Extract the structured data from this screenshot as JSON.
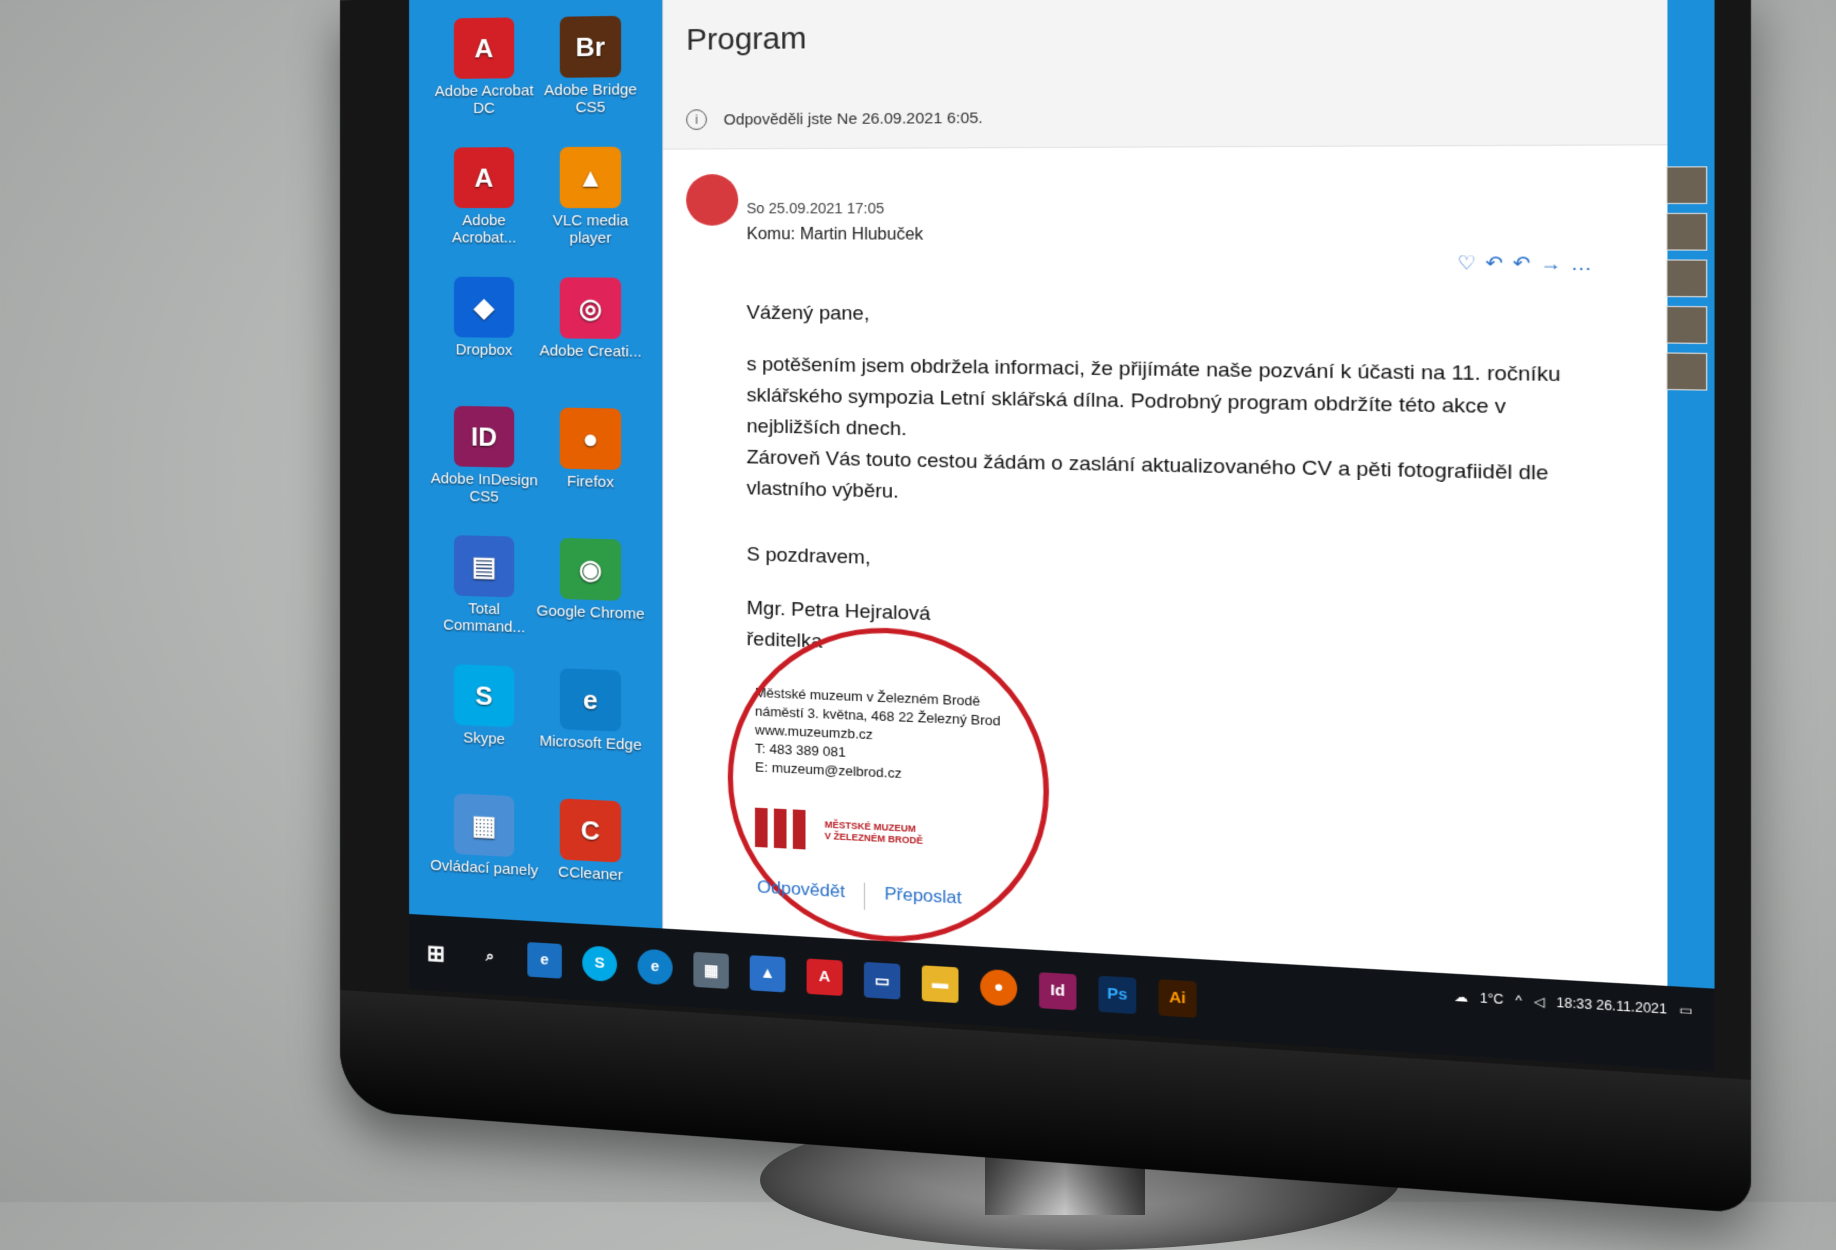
{
  "desktop_icons": [
    {
      "label": "Adobe Acrobat DC",
      "color": "#d31f26",
      "glyph": "A"
    },
    {
      "label": "Adobe Bridge CS5",
      "color": "#5a2e12",
      "glyph": "Br"
    },
    {
      "label": "Adobe Acrobat...",
      "color": "#d31f26",
      "glyph": "A"
    },
    {
      "label": "VLC media player",
      "color": "#f08a00",
      "glyph": "▲"
    },
    {
      "label": "Dropbox",
      "color": "#0d63d6",
      "glyph": "◆"
    },
    {
      "label": "Adobe Creati...",
      "color": "#e0245a",
      "glyph": "◎"
    },
    {
      "label": "Adobe InDesign CS5",
      "color": "#8c1c5b",
      "glyph": "ID"
    },
    {
      "label": "Firefox",
      "color": "#e66000",
      "glyph": "●"
    },
    {
      "label": "Total Command...",
      "color": "#3064c8",
      "glyph": "▤"
    },
    {
      "label": "Google Chrome",
      "color": "#2e9b47",
      "glyph": "◉"
    },
    {
      "label": "Skype",
      "color": "#00a8e6",
      "glyph": "S"
    },
    {
      "label": "Microsoft Edge",
      "color": "#0f7ec9",
      "glyph": "e"
    },
    {
      "label": "Ovládací panely",
      "color": "#4a8fd6",
      "glyph": "▦"
    },
    {
      "label": "CCleaner",
      "color": "#d6331f",
      "glyph": "C"
    }
  ],
  "email": {
    "title": "Program",
    "reply_note": "Odpověděli jste Ne 26.09.2021 6:05.",
    "date": "So 25.09.2021 17:05",
    "to": "Komu: Martin Hlubuček",
    "greeting": "Vážený pane,",
    "paragraph1": "s potěšením jsem obdržela informaci, že přijímáte naše pozvání k účasti na 11. ročníku sklářského sympozia Letní sklářská dílna. Podrobný program obdržíte této akce v nejbližších dnech.",
    "paragraph2": "Zároveň Vás touto cestou žádám o zaslání aktualizovaného CV a pěti fotografiiděl dle vlastního výběru.",
    "closing": "S pozdravem,",
    "sender_name": "Mgr. Petra Hejralová",
    "sender_role": "ředitelka",
    "signature": {
      "line1": "Městské muzeum v Železném Brodě",
      "line2": "náměstí 3. května, 468 22 Železný Brod",
      "line3": "www.muzeumzb.cz",
      "line4": "T: 483 389 081",
      "line5": "E: muzeum@zelbrod.cz"
    },
    "logo_text_1": "MĚSTSKÉ MUZEUM",
    "logo_text_2": "V ŽELEZNÉM BRODĚ",
    "reply_label": "Odpovědět",
    "forward_label": "Přeposlat"
  },
  "tray": {
    "temp": "1°C",
    "time": "18:33",
    "date": "26.11.2021"
  }
}
